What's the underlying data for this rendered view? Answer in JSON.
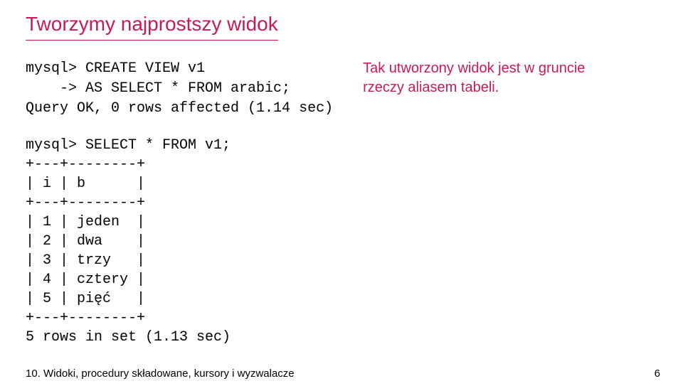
{
  "heading": "Tworzymy najprostszy widok",
  "code_left": "mysql> CREATE VIEW v1\n    -> AS SELECT * FROM arabic;\nQuery OK, 0 rows affected (1.14 sec)",
  "note_right": "Tak utworzony widok jest w gruncie rzeczy aliasem tabeli.",
  "code_block2": "mysql> SELECT * FROM v1;\n+---+--------+\n| i | b      |\n+---+--------+\n| 1 | jeden  |\n| 2 | dwa    |\n| 3 | trzy   |\n| 4 | cztery |\n| 5 | pięć   |\n+---+--------+\n5 rows in set (1.13 sec)",
  "footer": {
    "title": "10. Widoki, procedury składowane, kursory i wyzwalacze",
    "page": "6"
  }
}
